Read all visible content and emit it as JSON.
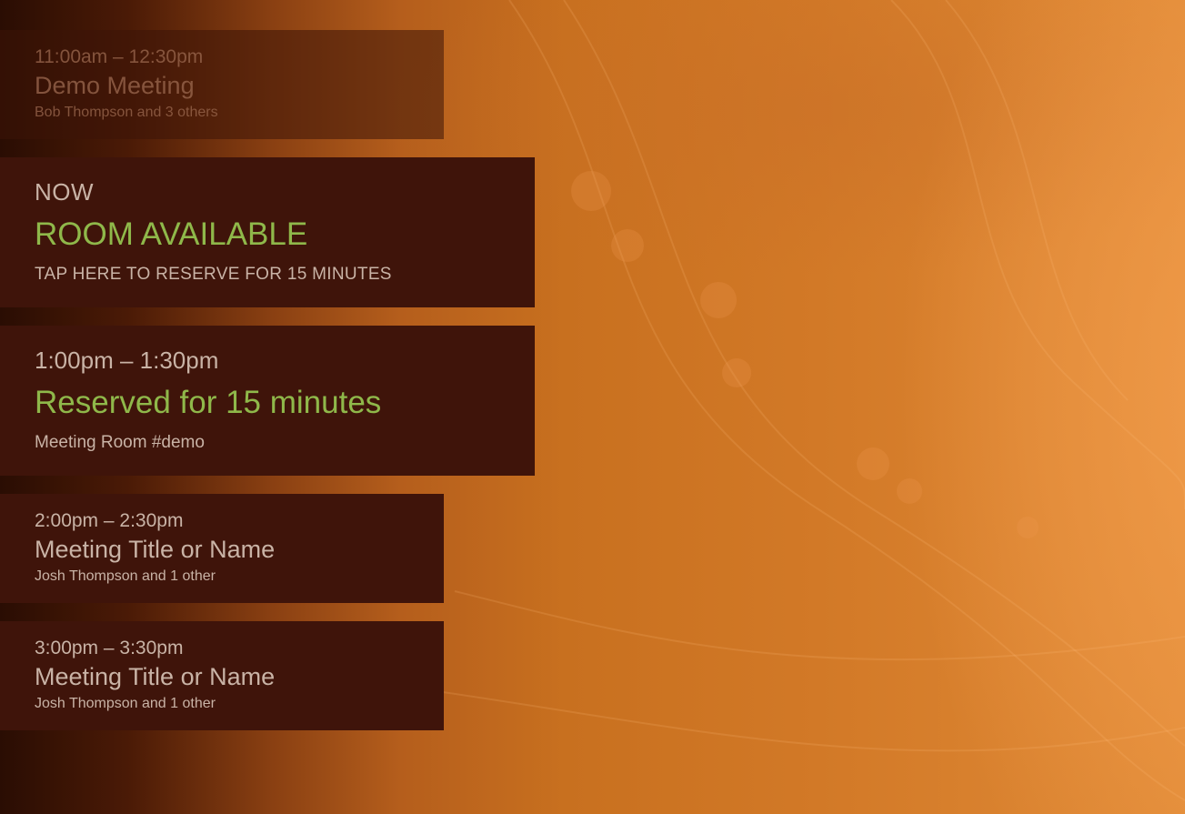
{
  "schedule": {
    "past": {
      "time": "11:00am – 12:30pm",
      "title": "Demo Meeting",
      "attendees": "Bob Thompson and 3 others"
    },
    "now": {
      "label": "NOW",
      "status": "ROOM AVAILABLE",
      "action": "TAP HERE TO RESERVE FOR 15 MINUTES"
    },
    "reserved": {
      "time": "1:00pm – 1:30pm",
      "status": "Reserved for 15 minutes",
      "room": "Meeting Room #demo"
    },
    "upcoming": [
      {
        "time": "2:00pm – 2:30pm",
        "title": "Meeting Title or Name",
        "attendees": "Josh Thompson and 1 other"
      },
      {
        "time": "3:00pm – 3:30pm",
        "title": "Meeting Title or Name",
        "attendees": "Josh Thompson and 1 other"
      }
    ]
  },
  "colors": {
    "card_bg": "#3f140a",
    "text": "#c9b3a6",
    "accent_green": "#8fb84a",
    "background_orange": "#d27927"
  }
}
